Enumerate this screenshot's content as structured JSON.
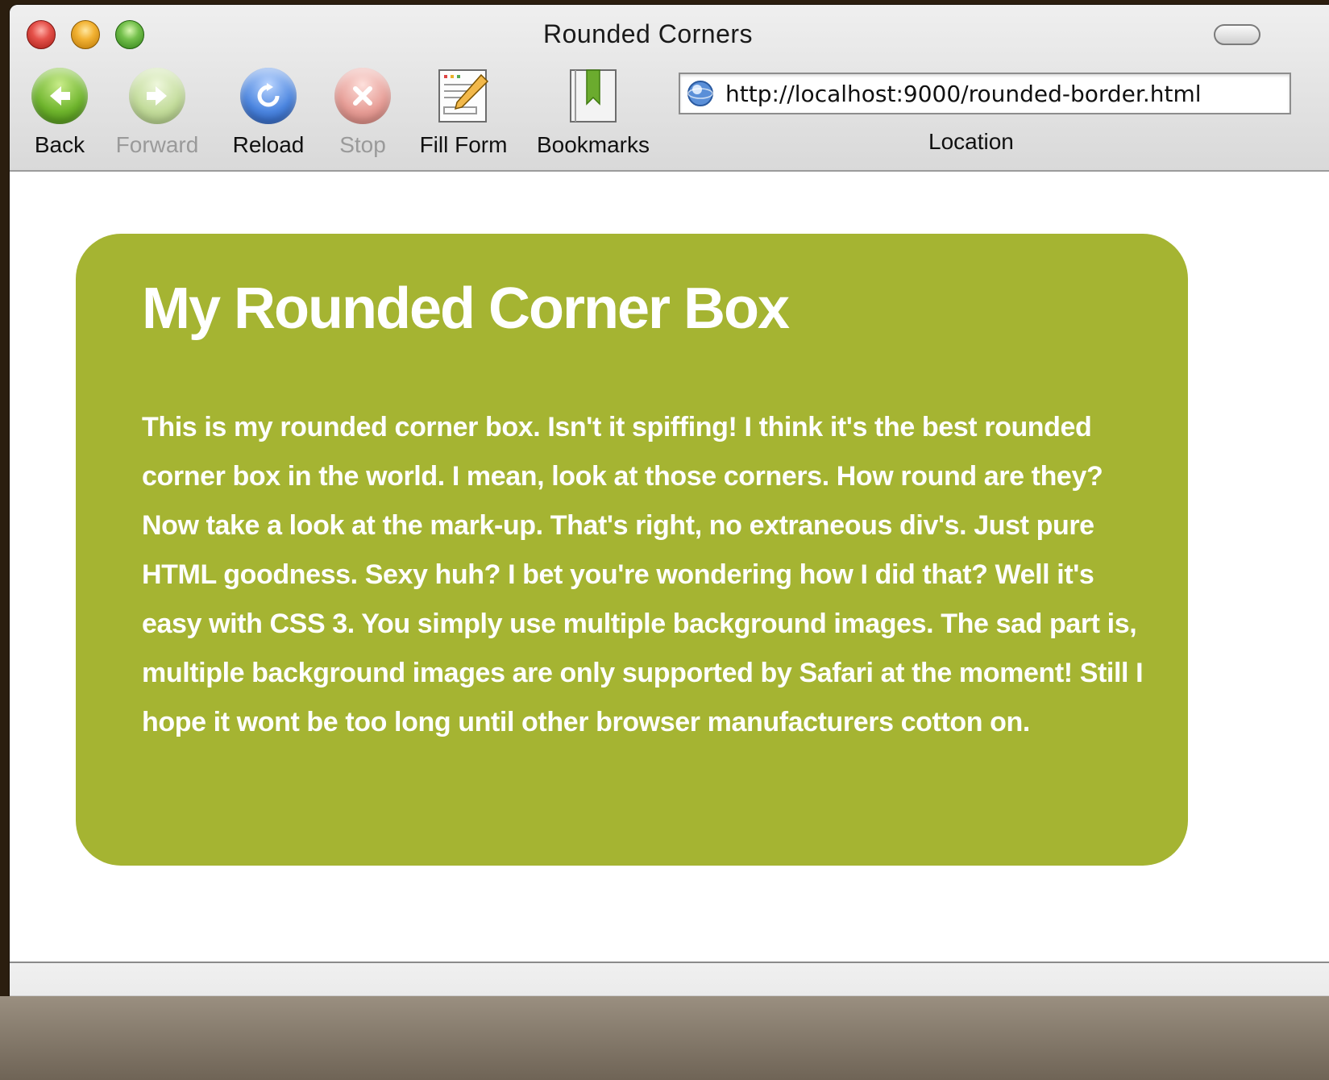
{
  "window": {
    "title": "Rounded Corners"
  },
  "toolbar": {
    "back_label": "Back",
    "forward_label": "Forward",
    "reload_label": "Reload",
    "stop_label": "Stop",
    "fill_form_label": "Fill Form",
    "bookmarks_label": "Bookmarks",
    "location_label": "Location",
    "url": "http://localhost:9000/rounded-border.html"
  },
  "page": {
    "heading": "My Rounded Corner Box",
    "body": "This is my rounded corner box. Isn't it spiffing! I think it's the best rounded corner box in the world. I mean, look at those corners. How round are they? Now take a look at the mark-up. That's right, no extraneous div's. Just pure HTML goodness.  Sexy huh? I bet you're wondering how I did that? Well it's easy with CSS 3. You simply use multiple background images. The sad part is, multiple background images are only supported by Safari at the moment! Still I hope it wont be too long until other browser manufacturers cotton on.",
    "box_color": "#a5b432"
  },
  "icons": {
    "back": "back-arrow-icon",
    "forward": "forward-arrow-icon",
    "reload": "reload-icon",
    "stop": "stop-icon",
    "fill_form": "fill-form-icon",
    "bookmarks": "bookmarks-icon",
    "site": "globe-icon"
  }
}
